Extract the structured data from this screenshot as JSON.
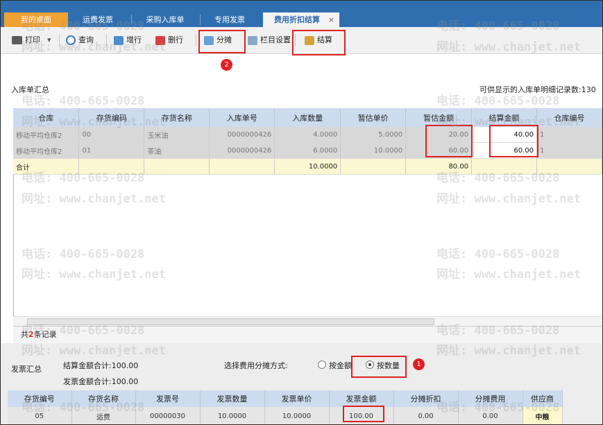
{
  "tabs": [
    "我的桌面",
    "运费发票",
    "采购入库单",
    "专用发票",
    "费用折扣结算"
  ],
  "tab_close": "×",
  "toolbar": {
    "print": "打印",
    "print_arrow": "▾",
    "query": "查询",
    "add_row": "增行",
    "del_row": "删行",
    "allocate": "分摊",
    "columns": "栏目设置",
    "settle": "结算"
  },
  "badges": {
    "allocate": "2",
    "by_quantity": "1"
  },
  "inbound": {
    "title": "入库单汇总",
    "record_info": "可供显示的入库单明细记录数:130",
    "columns": [
      "仓库",
      "存货编码",
      "存货名称",
      "入库单号",
      "入库数量",
      "暂估单价",
      "暂估金额",
      "结算金额",
      "仓库编号"
    ],
    "rows": [
      [
        "移动平均仓库2",
        "00",
        "玉米油",
        "0000000426",
        "4.0000",
        "5.0000",
        "20.00",
        "40.00",
        "1"
      ],
      [
        "移动平均仓库2",
        "01",
        "茶油",
        "0000000426",
        "6.0000",
        "10.0000",
        "60.00",
        "60.00",
        "1"
      ]
    ],
    "total": {
      "label": "合计",
      "qty": "10.0000",
      "amount": "80.00"
    },
    "footer_prefix": "共",
    "footer_count": "2",
    "footer_suffix": "条记录"
  },
  "invoice": {
    "title": "发票汇总",
    "settle_total": "结算金额合计:100.00",
    "invoice_total": "发票金额合计:100.00",
    "method_label": "选择费用分摊方式:",
    "by_amount": "按金额",
    "by_quantity": "按数量",
    "columns": [
      "存货编号",
      "存货名称",
      "发票号",
      "发票数量",
      "发票单价",
      "发票金额",
      "分摊折扣",
      "分摊费用",
      "供应商"
    ],
    "rows": [
      [
        "05",
        "运费",
        "00000030",
        "10.0000",
        "10.0000",
        "100.00",
        "0.00",
        "0.00",
        "中粮"
      ]
    ]
  },
  "watermark": {
    "phone": "电话: 400-665-0028",
    "site": "网址: www.chanjet.net"
  },
  "colors": {
    "tabbar": "#2f6fb0",
    "home_tab": "#f0a133",
    "highlight": "#e02020",
    "total_row": "#fbf7d2"
  }
}
